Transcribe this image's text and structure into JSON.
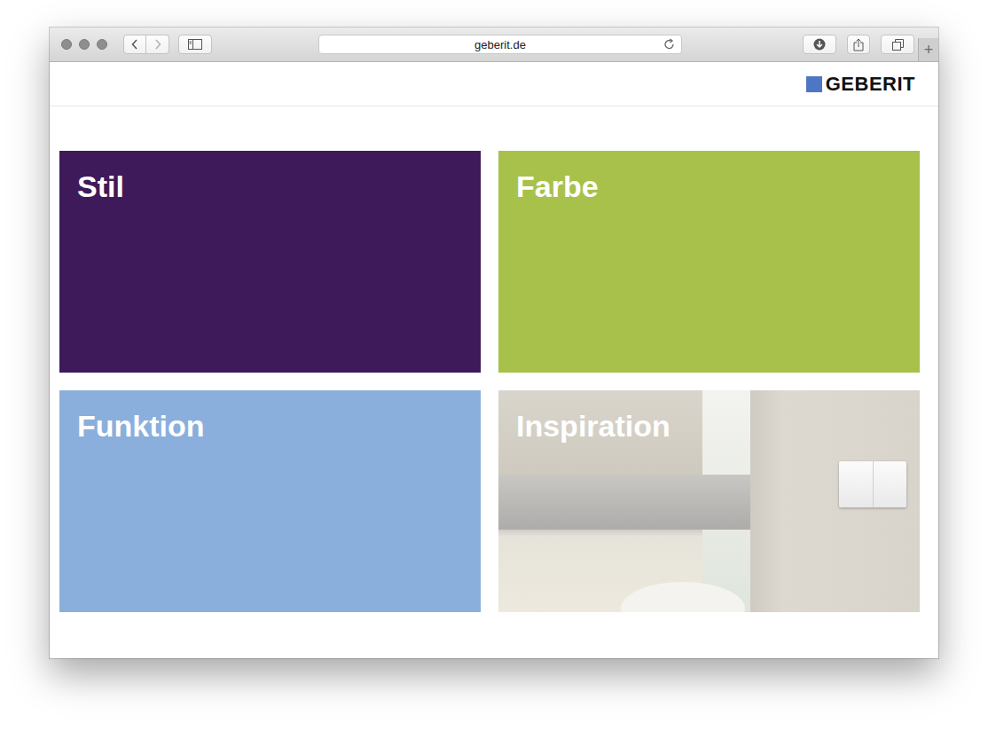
{
  "window": {
    "url": "geberit.de",
    "new_tab": "+"
  },
  "logo": "GEBERIT",
  "tiles": [
    {
      "title": "Stil",
      "kind": "color",
      "color": "#3f1a5a"
    },
    {
      "title": "Farbe",
      "kind": "color",
      "color": "#a8c14b"
    },
    {
      "title": "Funktion",
      "kind": "color",
      "color": "#8aafdc"
    },
    {
      "title": "Inspiration",
      "kind": "image",
      "color": "#cdc9c0"
    }
  ]
}
